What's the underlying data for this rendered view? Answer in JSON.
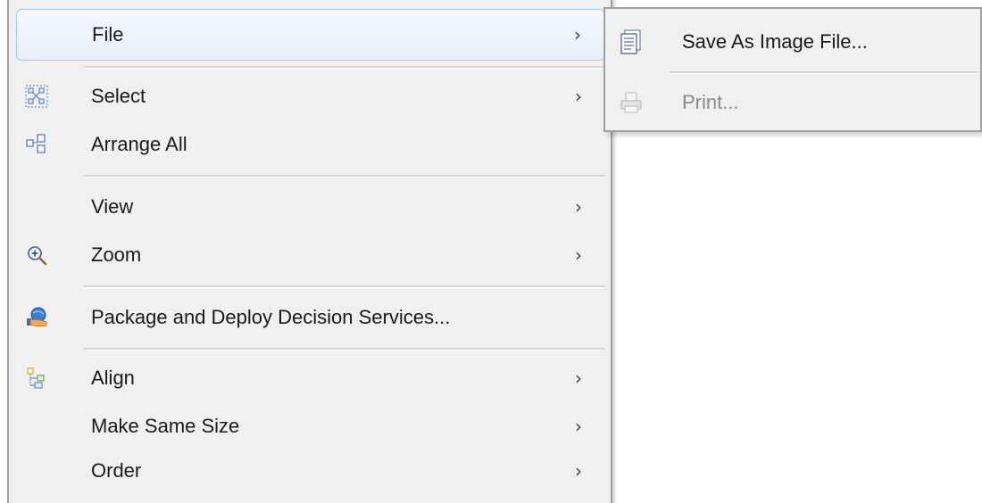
{
  "context_menu": {
    "items": [
      {
        "label": "File",
        "icon": null,
        "has_submenu": true,
        "highlighted": true
      },
      {
        "label": "Select",
        "icon": "select-nodes-icon",
        "has_submenu": true
      },
      {
        "label": "Arrange All",
        "icon": "arrange-all-icon",
        "has_submenu": false
      },
      {
        "label": "View",
        "icon": null,
        "has_submenu": true
      },
      {
        "label": "Zoom",
        "icon": "zoom-in-icon",
        "has_submenu": true
      },
      {
        "label": "Package and Deploy Decision Services...",
        "icon": "deploy-icon",
        "has_submenu": false
      },
      {
        "label": "Align",
        "icon": "align-icon",
        "has_submenu": true
      },
      {
        "label": "Make Same Size",
        "icon": null,
        "has_submenu": true
      },
      {
        "label": "Order",
        "icon": null,
        "has_submenu": true
      }
    ],
    "arrow": "›"
  },
  "file_submenu": {
    "items": [
      {
        "label": "Save As Image File...",
        "icon": "save-image-icon",
        "enabled": true
      },
      {
        "label": "Print...",
        "icon": "print-icon",
        "enabled": false
      }
    ]
  },
  "colors": {
    "menu_bg": "#f0f0f0",
    "highlight_border": "#a8c6ea",
    "disabled_text": "#8a8a8a"
  }
}
